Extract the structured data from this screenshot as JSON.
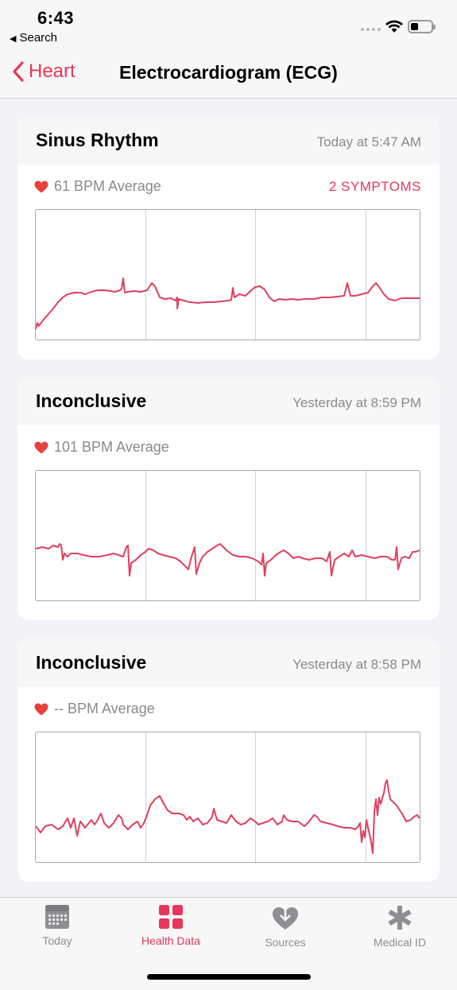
{
  "status_bar": {
    "time": "6:43",
    "back_app_label": "Search"
  },
  "nav": {
    "back_label": "Heart",
    "title": "Electrocardiogram (ECG)"
  },
  "colors": {
    "accent": "#e7365a",
    "heart": "#e8403c",
    "secondary_text": "#8a8a8e",
    "ecg_line": "#e0405f"
  },
  "recordings": [
    {
      "title": "Sinus Rhythm",
      "time": "Today at 5:47 AM",
      "bpm": "61 BPM Average",
      "symptoms": "2 SYMPTOMS"
    },
    {
      "title": "Inconclusive",
      "time": "Yesterday at 8:59 PM",
      "bpm": "101 BPM Average",
      "symptoms": ""
    },
    {
      "title": "Inconclusive",
      "time": "Yesterday at 8:58 PM",
      "bpm": "-- BPM Average",
      "symptoms": ""
    }
  ],
  "tabs": [
    {
      "label": "Today",
      "icon": "calendar-icon",
      "active": false
    },
    {
      "label": "Health Data",
      "icon": "grid-icon",
      "active": true
    },
    {
      "label": "Sources",
      "icon": "heart-download-icon",
      "active": false
    },
    {
      "label": "Medical ID",
      "icon": "asterisk-icon",
      "active": false
    }
  ]
}
